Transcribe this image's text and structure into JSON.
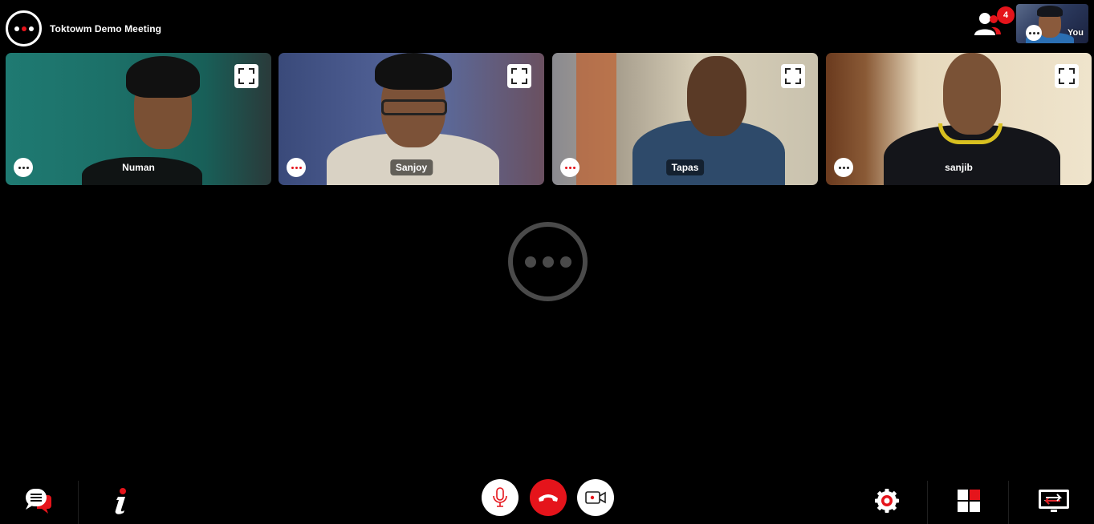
{
  "header": {
    "meeting_title": "Toktowm Demo Meeting",
    "participant_count": "4",
    "self_label": "You"
  },
  "tiles": [
    {
      "name": "Numan",
      "more_alert": false
    },
    {
      "name": "Sanjoy",
      "more_alert": true
    },
    {
      "name": "Tapas",
      "more_alert": true
    },
    {
      "name": "sanjib",
      "more_alert": false
    }
  ],
  "colors": {
    "accent": "#e5141b",
    "background": "#000000",
    "loader": "#4a4a4a"
  },
  "toolbar": {
    "left": [
      "chat-icon",
      "info-icon"
    ],
    "center": [
      "microphone-icon",
      "end-call-icon",
      "video-camera-icon"
    ],
    "right": [
      "settings-icon",
      "grid-layout-icon",
      "screen-share-icon"
    ]
  }
}
